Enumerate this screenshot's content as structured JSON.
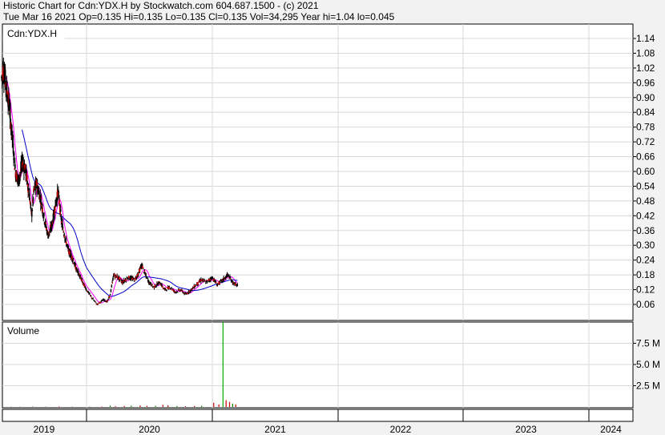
{
  "header": {
    "line1": "Historic Chart for Cdn:YDX.H by Stockwatch.com 604.687.1500 - (c) 2021",
    "line2": "Tue Mar 16 2021  Op=0.135  Hi=0.135  Lo=0.135  Cl=0.135  Vol=34,295  Year hi=1.04  lo=0.045"
  },
  "chart_data": [
    {
      "type": "candlestick",
      "panel_label": "Cdn:YDX.H",
      "ylim": [
        0,
        1.18
      ],
      "yticks": [
        "0.06",
        "0.12",
        "0.18",
        "0.24",
        "0.30",
        "0.36",
        "0.42",
        "0.48",
        "0.54",
        "0.60",
        "0.66",
        "0.72",
        "0.78",
        "0.84",
        "0.90",
        "0.96",
        "1.02",
        "1.08",
        "1.14"
      ],
      "x_years": [
        "2019",
        "2020",
        "2021",
        "2022",
        "2023",
        "2024"
      ],
      "x_range": [
        "2019-01",
        "2024-06"
      ],
      "grid": true,
      "price_path": [
        [
          "2019-01-01",
          0.98
        ],
        [
          "2019-01-10",
          1.02
        ],
        [
          "2019-01-20",
          0.95
        ],
        [
          "2019-02-01",
          0.88
        ],
        [
          "2019-02-15",
          0.75
        ],
        [
          "2019-03-01",
          0.6
        ],
        [
          "2019-03-15",
          0.56
        ],
        [
          "2019-04-01",
          0.64
        ],
        [
          "2019-04-15",
          0.6
        ],
        [
          "2019-05-01",
          0.5
        ],
        [
          "2019-05-10",
          0.42
        ],
        [
          "2019-05-20",
          0.52
        ],
        [
          "2019-06-01",
          0.55
        ],
        [
          "2019-06-20",
          0.48
        ],
        [
          "2019-07-05",
          0.4
        ],
        [
          "2019-07-20",
          0.34
        ],
        [
          "2019-08-05",
          0.38
        ],
        [
          "2019-08-20",
          0.46
        ],
        [
          "2019-09-01",
          0.52
        ],
        [
          "2019-09-15",
          0.4
        ],
        [
          "2019-10-01",
          0.33
        ],
        [
          "2019-10-15",
          0.28
        ],
        [
          "2019-11-01",
          0.25
        ],
        [
          "2019-11-15",
          0.21
        ],
        [
          "2019-12-01",
          0.18
        ],
        [
          "2019-12-15",
          0.15
        ],
        [
          "2020-01-01",
          0.12
        ],
        [
          "2020-01-15",
          0.09
        ],
        [
          "2020-02-01",
          0.06
        ],
        [
          "2020-02-20",
          0.08
        ],
        [
          "2020-03-01",
          0.07
        ],
        [
          "2020-03-10",
          0.1
        ],
        [
          "2020-03-20",
          0.18
        ],
        [
          "2020-04-01",
          0.17
        ],
        [
          "2020-04-15",
          0.15
        ],
        [
          "2020-05-01",
          0.17
        ],
        [
          "2020-05-20",
          0.16
        ],
        [
          "2020-06-01",
          0.19
        ],
        [
          "2020-06-10",
          0.22
        ],
        [
          "2020-06-20",
          0.18
        ],
        [
          "2020-07-01",
          0.15
        ],
        [
          "2020-07-15",
          0.13
        ],
        [
          "2020-08-01",
          0.15
        ],
        [
          "2020-08-15",
          0.12
        ],
        [
          "2020-09-01",
          0.13
        ],
        [
          "2020-09-15",
          0.11
        ],
        [
          "2020-10-01",
          0.12
        ],
        [
          "2020-10-15",
          0.1
        ],
        [
          "2020-11-01",
          0.12
        ],
        [
          "2020-11-15",
          0.14
        ],
        [
          "2020-12-01",
          0.16
        ],
        [
          "2020-12-15",
          0.15
        ],
        [
          "2021-01-01",
          0.17
        ],
        [
          "2021-01-15",
          0.14
        ],
        [
          "2021-02-01",
          0.16
        ],
        [
          "2021-02-15",
          0.18
        ],
        [
          "2021-03-01",
          0.15
        ],
        [
          "2021-03-16",
          0.135
        ]
      ],
      "series": [
        {
          "name": "",
          "color": "#ff00ff",
          "kind": "short moving average"
        },
        {
          "name": "",
          "color": "#0000cc",
          "kind": "long moving average"
        }
      ]
    },
    {
      "type": "bar",
      "panel_label": "Volume",
      "ylim": [
        0,
        10000000
      ],
      "yticks": [
        "2.5 M",
        "5.0 M",
        "7.5 M"
      ],
      "bars": [
        [
          "2019-01-05",
          40000
        ],
        [
          "2019-02-10",
          30000
        ],
        [
          "2019-03-20",
          25000
        ],
        [
          "2019-05-15",
          50000
        ],
        [
          "2019-07-10",
          30000
        ],
        [
          "2019-09-05",
          60000
        ],
        [
          "2019-11-01",
          35000
        ],
        [
          "2020-01-10",
          40000
        ],
        [
          "2020-02-15",
          45000
        ],
        [
          "2020-03-10",
          150000
        ],
        [
          "2020-03-25",
          90000
        ],
        [
          "2020-04-20",
          120000
        ],
        [
          "2020-05-10",
          160000
        ],
        [
          "2020-06-05",
          180000
        ],
        [
          "2020-06-25",
          130000
        ],
        [
          "2020-07-20",
          140000
        ],
        [
          "2020-08-10",
          250000
        ],
        [
          "2020-08-25",
          200000
        ],
        [
          "2020-09-20",
          110000
        ],
        [
          "2020-10-15",
          90000
        ],
        [
          "2020-11-10",
          120000
        ],
        [
          "2020-12-01",
          150000
        ],
        [
          "2021-01-05",
          500000
        ],
        [
          "2021-01-20",
          300000
        ],
        [
          "2021-02-01",
          10000000
        ],
        [
          "2021-02-10",
          800000
        ],
        [
          "2021-02-20",
          600000
        ],
        [
          "2021-03-01",
          400000
        ],
        [
          "2021-03-10",
          300000
        ]
      ]
    }
  ]
}
